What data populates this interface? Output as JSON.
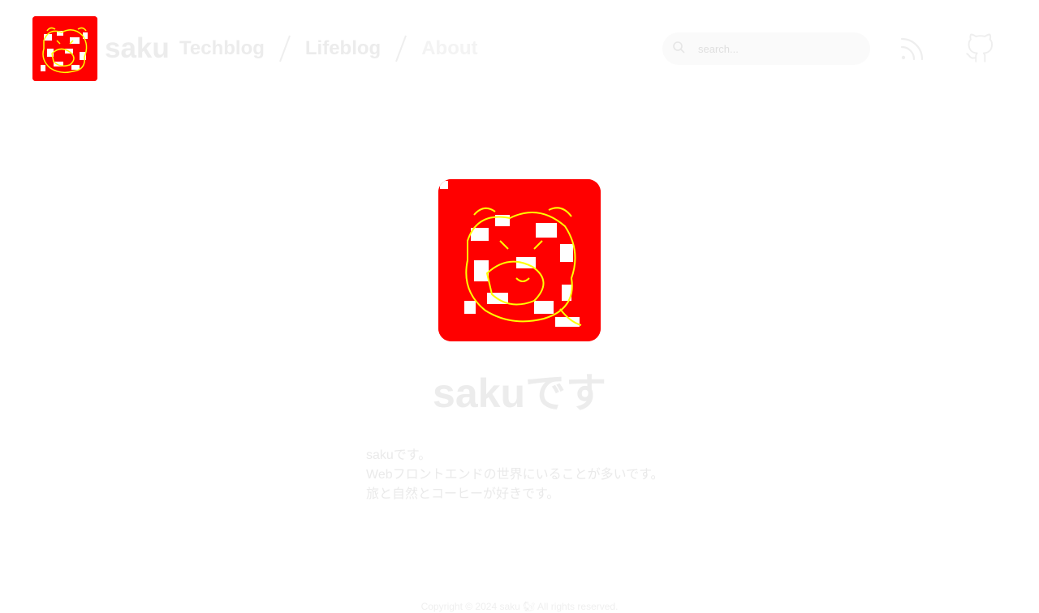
{
  "header": {
    "site_name": "saku",
    "logo_alt": "saku logo",
    "nav": [
      {
        "label": "Techblog"
      },
      {
        "label": "Lifeblog"
      },
      {
        "label": "About"
      }
    ],
    "search": {
      "placeholder": "search..."
    },
    "rss_icon": "rss-icon",
    "github_icon": "github-icon"
  },
  "profile": {
    "title": "sakuです",
    "bio": [
      "sakuです。",
      "Webフロントエンドの世界にいることが多いです。",
      "旅と自然とコーヒーが好きです。"
    ]
  },
  "footer": {
    "copyright": "Copyright © 2024 saku 🐿 All rights reserved."
  },
  "colors": {
    "logo_background": "#ff0000",
    "logo_drawing": "#ffff00",
    "text_faded": "#ececec"
  }
}
